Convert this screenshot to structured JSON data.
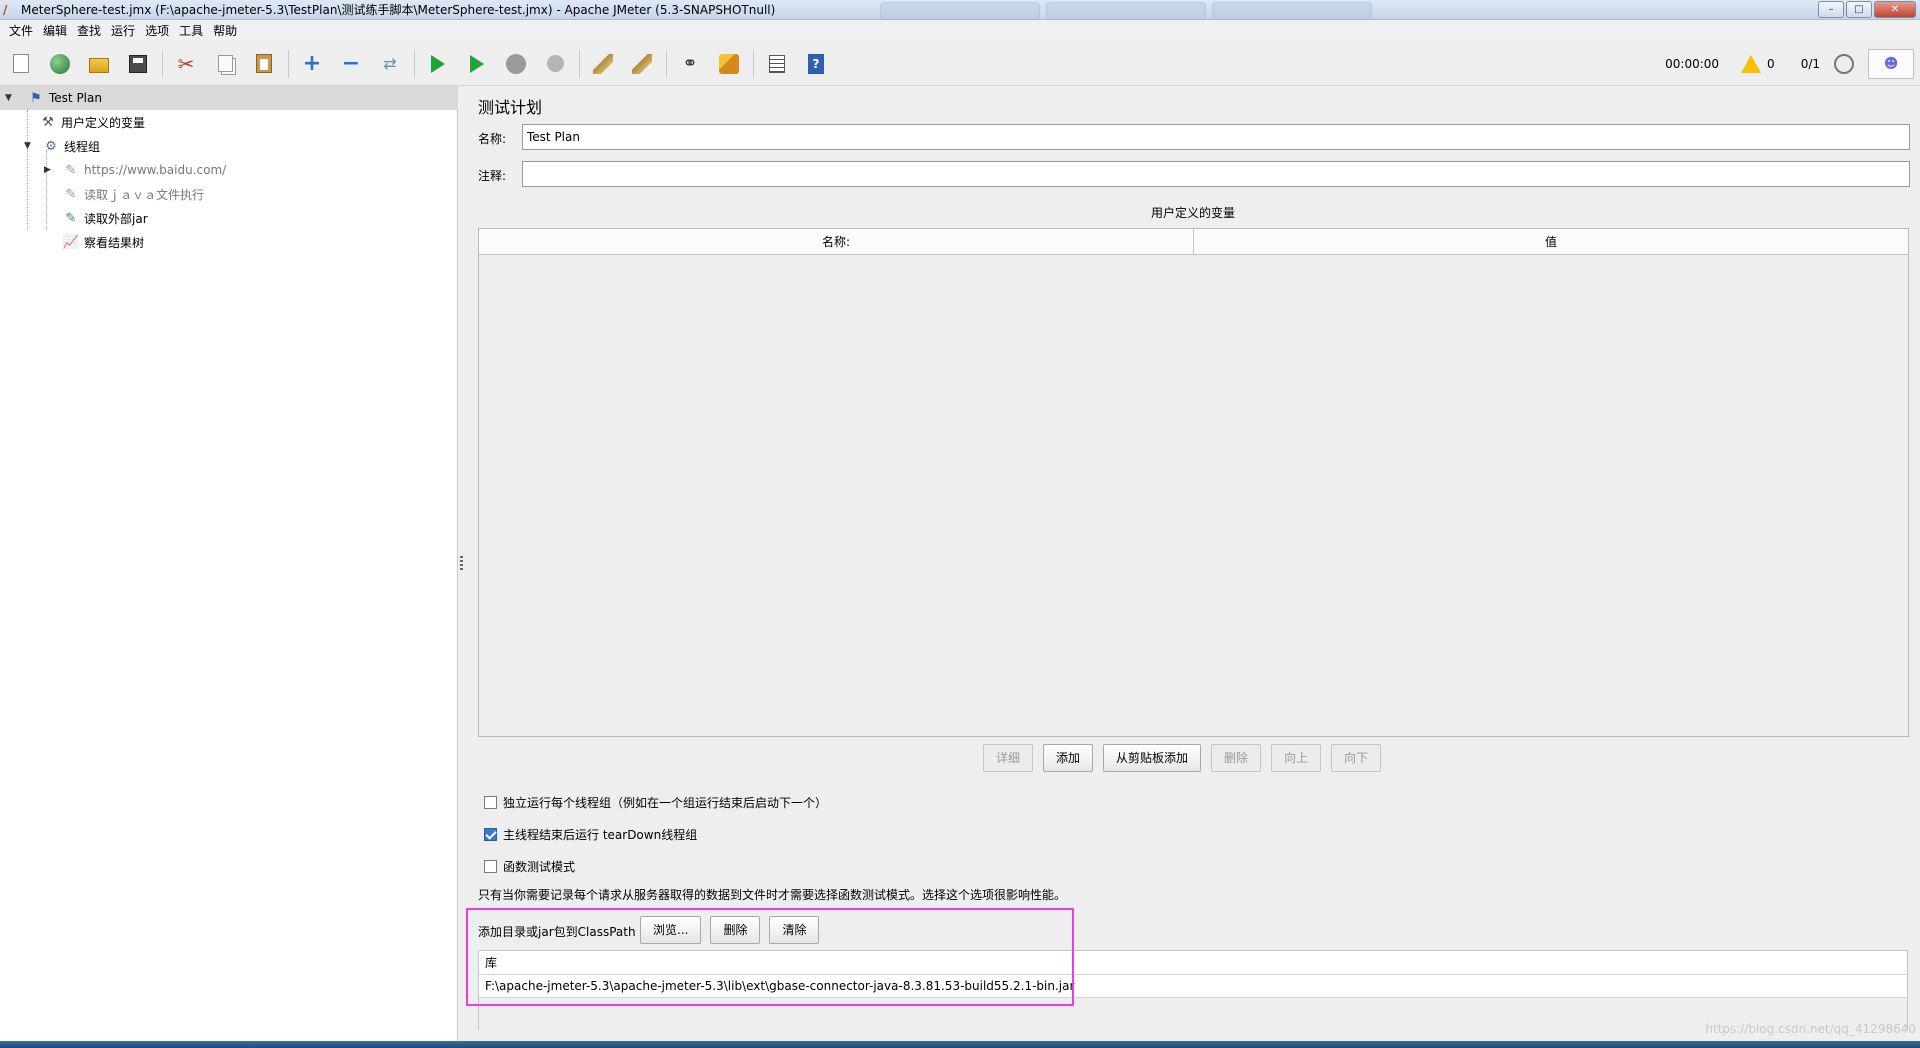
{
  "window": {
    "title": "MeterSphere-test.jmx (F:\\apache-jmeter-5.3\\TestPlan\\测试练手脚本\\MeterSphere-test.jmx) - Apache JMeter (5.3-SNAPSHOTnull)",
    "controls": [
      "–",
      "□",
      "✕"
    ]
  },
  "menu": [
    "文件",
    "编辑",
    "查找",
    "运行",
    "选项",
    "工具",
    "帮助"
  ],
  "toolbar": {
    "icons": [
      "new-icon",
      "templates-icon",
      "open-icon",
      "save-icon",
      "cut-icon",
      "copy-icon",
      "paste-icon",
      "expand-icon",
      "collapse-icon",
      "toggle-icon",
      "start-icon",
      "start-no-timers-icon",
      "stop-icon",
      "shutdown-icon",
      "clear-icon",
      "clear-all-icon",
      "search-icon",
      "reset-search-icon",
      "function-helper-icon",
      "help-icon"
    ],
    "timer": "00:00:00",
    "warnings": "0",
    "threads": "0/1"
  },
  "tree": {
    "items": [
      {
        "label": "Test Plan",
        "icon": "test-plan-icon"
      },
      {
        "label": "用户定义的变量",
        "icon": "config-tools-icon"
      },
      {
        "label": "线程组",
        "icon": "gear-icon"
      },
      {
        "label": "https://www.baidu.com/",
        "icon": "sampler-pen-icon"
      },
      {
        "label": "读取ｊａｖａ文件执行",
        "icon": "sampler-pen-icon"
      },
      {
        "label": "读取外部jar",
        "icon": "sampler-pen-icon"
      },
      {
        "label": "察看结果树",
        "icon": "listener-chart-icon"
      }
    ]
  },
  "panel": {
    "title": "测试计划",
    "name_label": "名称:",
    "name_value": "Test Plan",
    "comment_label": "注释:",
    "comment_value": "",
    "vars_title": "用户定义的变量",
    "columns": [
      "名称:",
      "值"
    ],
    "buttons": {
      "detail": "详细",
      "add": "添加",
      "add_clipboard": "从剪贴板添加",
      "delete": "删除",
      "up": "向上",
      "down": "向下"
    },
    "checkboxes": [
      {
        "label": "独立运行每个线程组（例如在一个组运行结束后启动下一个）",
        "checked": false
      },
      {
        "label": "主线程结束后运行 tearDown线程组",
        "checked": true
      },
      {
        "label": "函数测试模式",
        "checked": false
      }
    ],
    "note": "只有当你需要记录每个请求从服务器取得的数据到文件时才需要选择函数测试模式。选择这个选项很影响性能。",
    "classpath_label": "添加目录或jar包到ClassPath",
    "classpath_buttons": {
      "browse": "浏览...",
      "delete": "删除",
      "clear": "清除"
    },
    "library_header": "库",
    "library_rows": [
      "F:\\apache-jmeter-5.3\\apache-jmeter-5.3\\lib\\ext\\gbase-connector-java-8.3.81.53-build55.2.1-bin.jar"
    ]
  },
  "watermark": "https://blog.csdn.net/qq_41298640",
  "colors": {
    "highlight_border": "#ea3fdc",
    "selected_row": "#d9d9d9",
    "check_blue": "#3b79c9"
  }
}
